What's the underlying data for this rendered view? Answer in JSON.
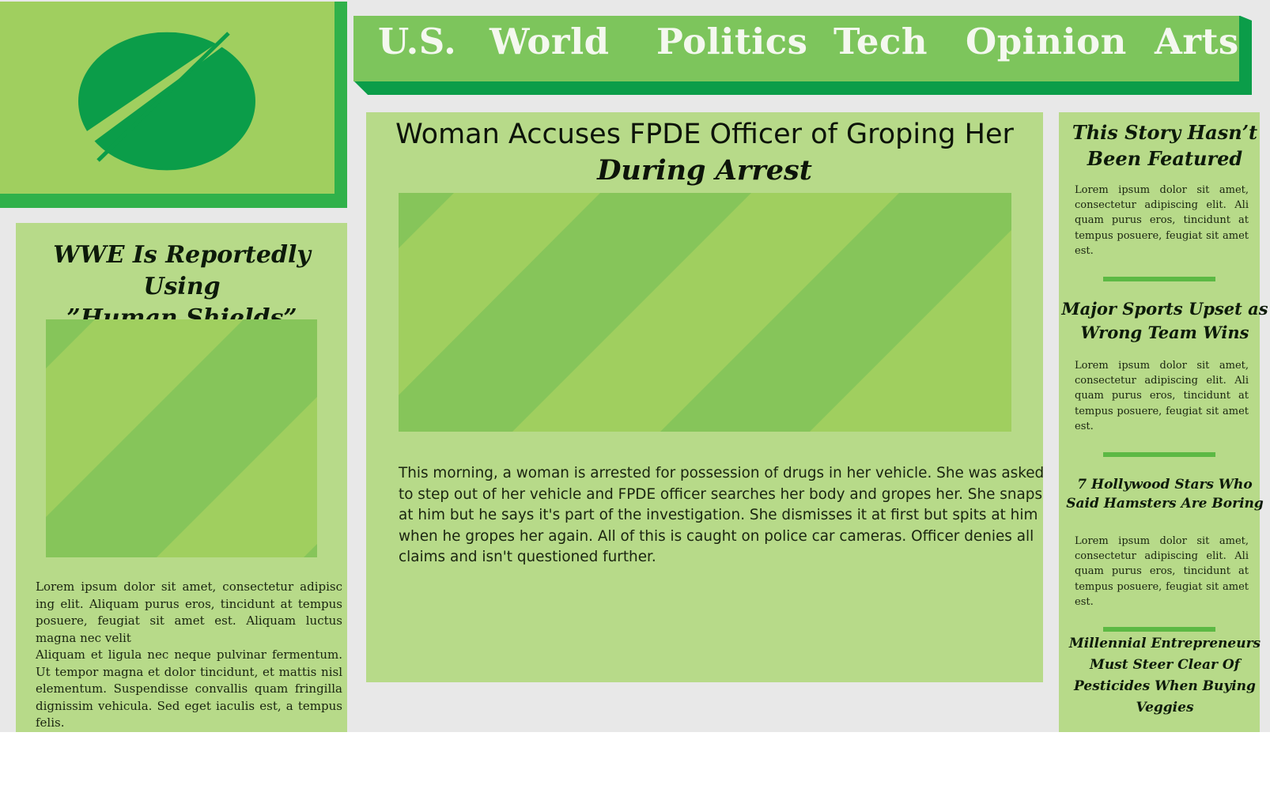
{
  "colors": {
    "page_background": "#e8e8e8",
    "panel_green": "#b7da89",
    "logo_green": "#a0cf5f",
    "nav_green": "#7dc55c",
    "dark_green": "#0b9d49",
    "accent_green": "#30b14a"
  },
  "logo": {
    "icon": "slashed-circle-logo"
  },
  "nav": {
    "items": [
      {
        "label": "U.S."
      },
      {
        "label": "World"
      },
      {
        "label": "Politics"
      },
      {
        "label": "Tech"
      },
      {
        "label": "Opinion"
      },
      {
        "label": "Arts"
      }
    ]
  },
  "left_story": {
    "title_line1": "WWE Is Reportedly Using",
    "title_line2": "”Human Shields”",
    "image": "image-placeholder",
    "body_p1": "Lorem ipsum dolor sit amet, consectetur adipisc ing elit. Aliquam purus eros, tincidunt at tempus posuere, feugiat sit amet est. Aliquam luctus magna nec velit",
    "body_p2": "Aliquam et ligula nec neque pulvinar fermentum. Ut tempor magna et dolor tincidunt, et mattis nisl elementum. Suspendisse convallis quam fringilla dignissim vehicula. Sed eget iaculis est, a tempus felis."
  },
  "main_story": {
    "title_line1": "Woman Accuses FPDE Officer of Groping Her",
    "title_line2": "During Arrest",
    "image": "image-placeholder",
    "body": "This morning, a woman is arrested for possession of drugs in her vehicle. She was asked to step out of her vehicle and FPDE officer searches her body and gropes her. She snaps at him but he says it's part of the investigation. She dismisses it at first but spits at him when he gropes her again. All of this is caught on police car cameras. Officer denies all claims and isn't questioned further."
  },
  "sidebar": {
    "stories": [
      {
        "title_line1": "This Story Hasn’t",
        "title_line2": "Been Featured",
        "body": "Lorem ipsum dolor sit amet, consectetur adipiscing elit. Ali quam purus eros, tincidunt at tempus posuere, feugiat sit amet est."
      },
      {
        "title_line1": "Major Sports Upset as",
        "title_line2": "Wrong Team Wins",
        "body": "Lorem ipsum dolor sit amet, consectetur adipiscing elit. Ali quam purus eros, tincidunt at tempus posuere, feugiat sit amet est."
      },
      {
        "title_line1": "7 Hollywood Stars Who",
        "title_line2": "Said Hamsters Are Boring",
        "body": "Lorem ipsum dolor sit amet, consectetur adipiscing elit. Ali quam purus eros, tincidunt at tempus posuere, feugiat sit amet est."
      },
      {
        "title_line1": "Millennial Entrepreneurs",
        "title_line2": "Must Steer Clear Of",
        "title_line3": "Pesticides When Buying",
        "title_line4": "Veggies"
      }
    ]
  }
}
